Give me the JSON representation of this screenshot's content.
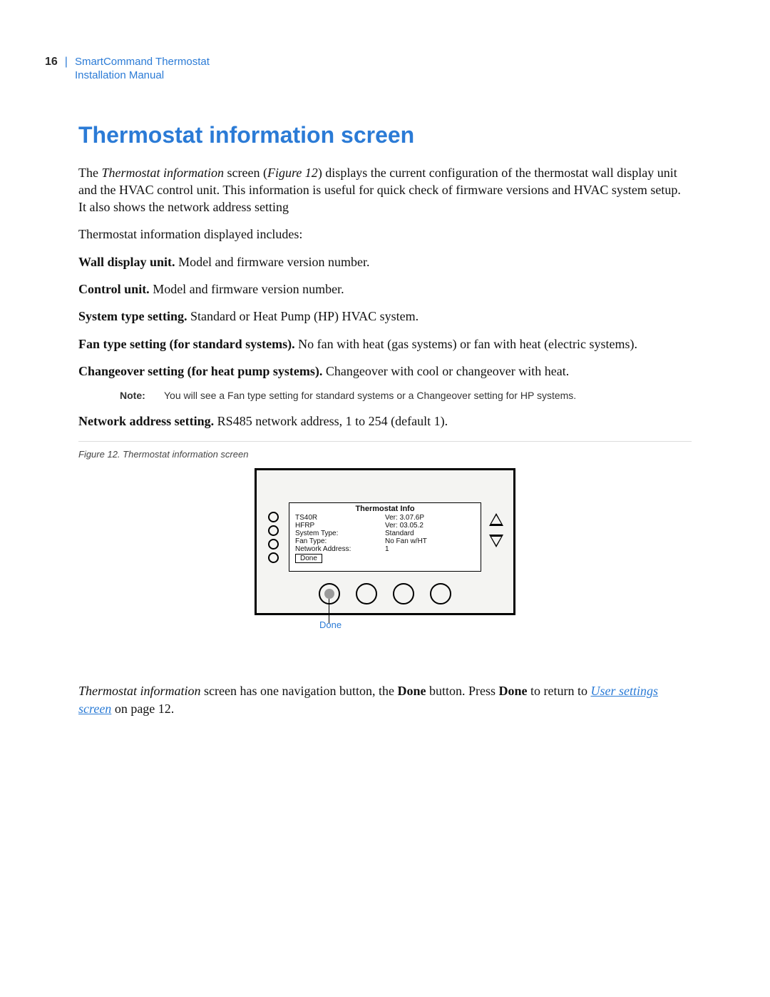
{
  "header": {
    "page_number": "16",
    "doc_title_line1": "SmartCommand Thermostat",
    "doc_title_line2": "Installation Manual"
  },
  "section": {
    "title": "Thermostat information screen",
    "p1_a": "The ",
    "p1_b_italic": "Thermostat information",
    "p1_c": " screen (",
    "p1_d_italic": "Figure 12",
    "p1_e": ") displays the current configuration of the thermostat wall display unit and the HVAC control unit. This information is useful for quick check of firmware versions and HVAC system setup. It also shows the network address setting",
    "p2": "Thermostat information displayed includes:",
    "items": [
      {
        "b": "Wall display unit.",
        "t": "  Model and firmware version number."
      },
      {
        "b": "Control unit.",
        "t": "  Model and firmware version number."
      },
      {
        "b": "System type setting.",
        "t": "  Standard or Heat Pump (HP) HVAC system."
      },
      {
        "b": "Fan type setting (for standard systems).",
        "t": "  No fan with heat (gas systems) or fan with heat (electric systems)."
      },
      {
        "b": "Changeover setting (for heat pump systems).",
        "t": "  Changeover with cool or changeover with heat."
      }
    ],
    "note_label": "Note:",
    "note_text": "You will see a Fan type setting for standard systems or a Changeover setting for HP systems.",
    "item_net_b": "Network address setting.",
    "item_net_t": "  RS485 network address, 1 to 254 (default 1)."
  },
  "figure": {
    "caption": "Figure 12.  Thermostat information screen",
    "lcd_title": "Thermostat Info",
    "rows": [
      {
        "l": "TS40R",
        "r": "Ver: 3.07.6P"
      },
      {
        "l": "HFRP",
        "r": "Ver: 03.05.2"
      },
      {
        "l": "System Type:",
        "r": "Standard"
      },
      {
        "l": "Fan Type:",
        "r": "No Fan w/HT"
      },
      {
        "l": "Network Address:",
        "r": "1"
      }
    ],
    "done_label": "Done",
    "callout": "Done"
  },
  "closing": {
    "a_italic": "Thermostat information",
    "b": " screen has one navigation button, the ",
    "c_bold": "Done",
    "d": " button. Press ",
    "e_bold": "Done",
    "f": " to return to ",
    "link": "User settings screen",
    "g": " on page 12."
  }
}
